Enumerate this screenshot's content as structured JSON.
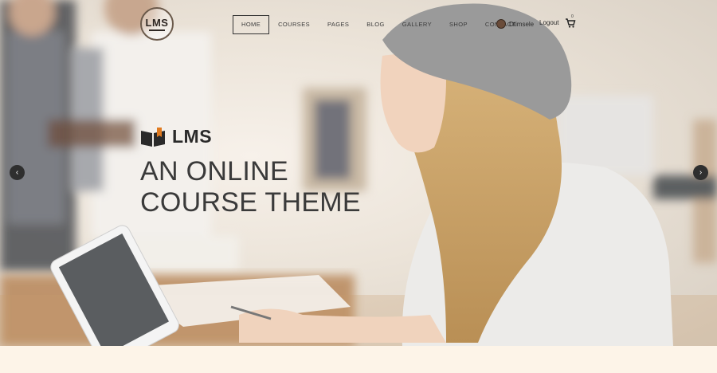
{
  "logo": {
    "text": "LMS"
  },
  "nav": {
    "items": [
      {
        "label": "HOME",
        "active": true
      },
      {
        "label": "COURSES"
      },
      {
        "label": "PAGES"
      },
      {
        "label": "BLOG"
      },
      {
        "label": "GALLERY"
      },
      {
        "label": "SHOP"
      },
      {
        "label": "CONTACT"
      }
    ]
  },
  "user": {
    "name": "Dtimsele",
    "logout": "Logout",
    "cart_count": "0"
  },
  "hero": {
    "brand": "LMS",
    "headline_line1": "AN ONLINE",
    "headline_line2": "COURSE THEME"
  },
  "slider": {
    "prev_icon": "chevron-left-icon",
    "next_icon": "chevron-right-icon",
    "prev_glyph": "‹",
    "next_glyph": "›"
  },
  "colors": {
    "background": "#fbf3e8",
    "text_dark": "#3a3a3a",
    "arrow_bg": "#2f2f2f"
  }
}
